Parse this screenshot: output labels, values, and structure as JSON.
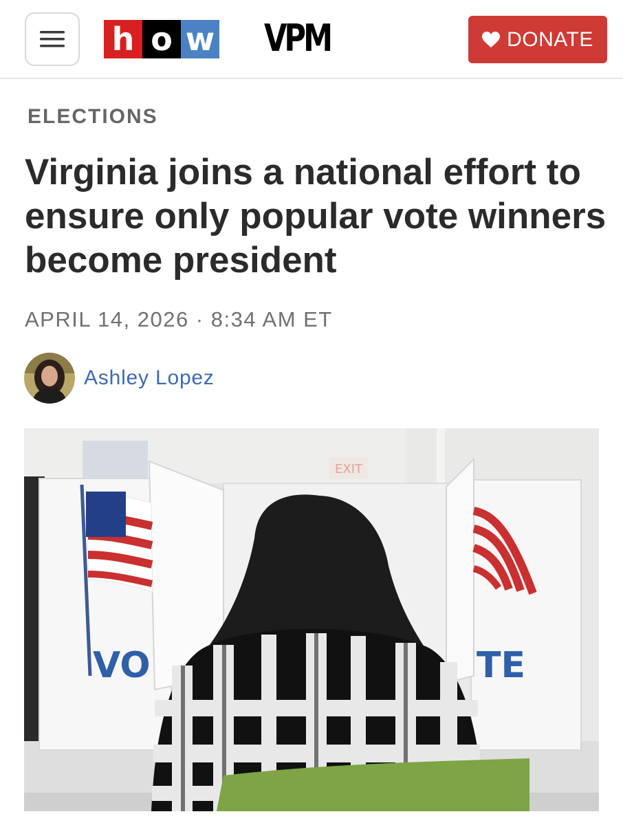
{
  "header": {
    "menu_icon": "hamburger-menu-icon",
    "logo_letters": [
      "h",
      "o",
      "w"
    ],
    "station_logo": "VPM",
    "donate_label": "DONATE",
    "donate_icon": "heart-icon",
    "colors": {
      "donate": "#cf3a34",
      "logo_red": "#d62021",
      "logo_black": "#000000",
      "logo_blue": "#4a82c4"
    }
  },
  "article": {
    "section": "ELECTIONS",
    "headline": "Virginia joins a national effort to ensure only popular vote winners become president",
    "dateline": "APRIL 14, 2026 · 8:34 AM ET",
    "author": "Ashley Lopez",
    "author_color": "#3f6ab1",
    "photo": {
      "booth_left_text": "VO",
      "booth_right_text": "TE",
      "exit_sign": "EXIT"
    }
  }
}
